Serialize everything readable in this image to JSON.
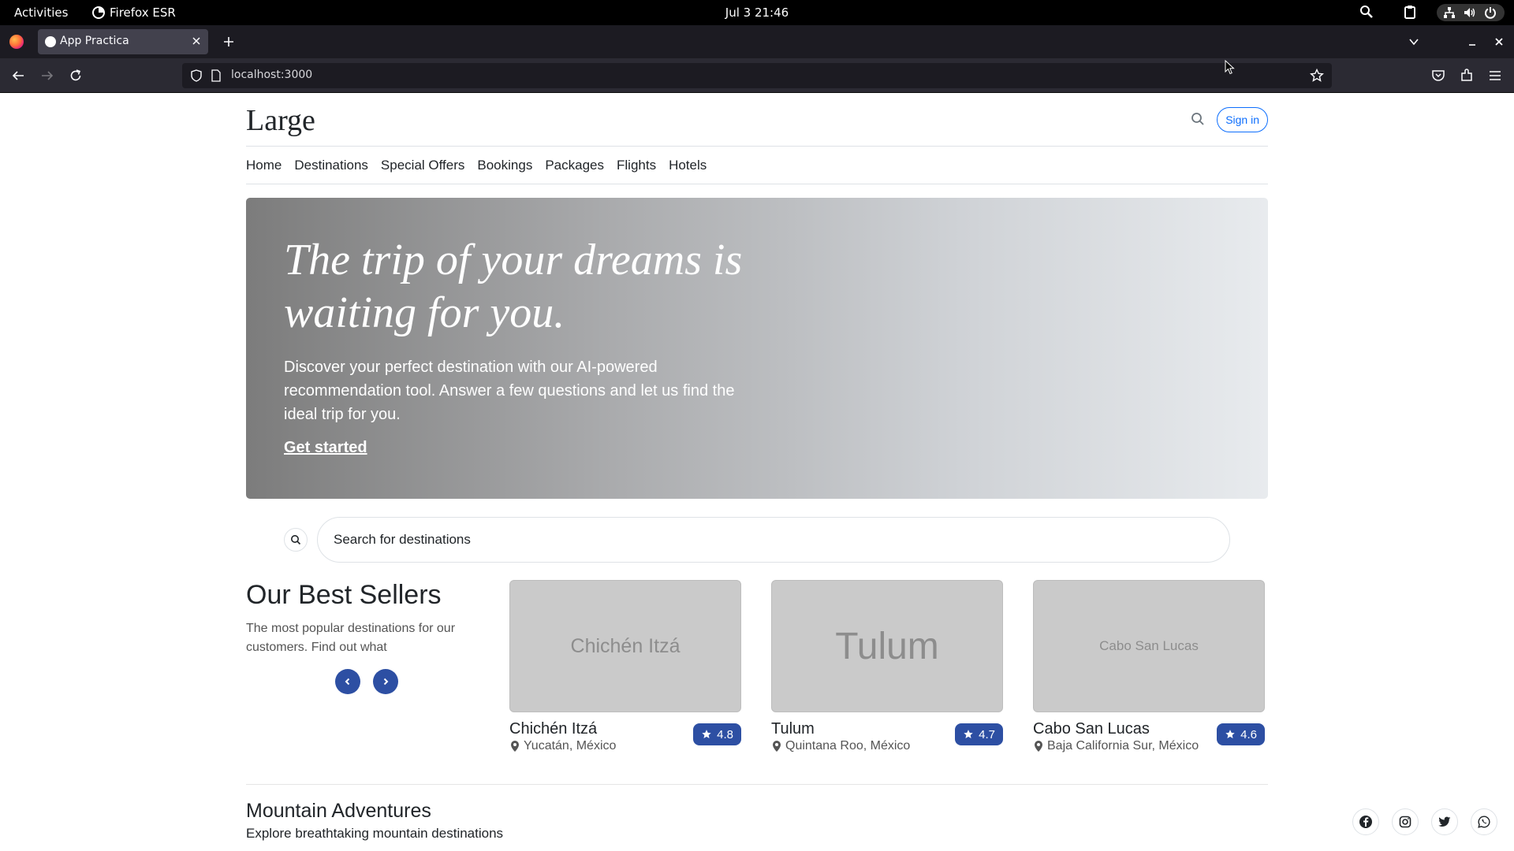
{
  "system": {
    "activities": "Activities",
    "app_name": "Firefox ESR",
    "clock": "Jul 3  21:46"
  },
  "browser": {
    "tab_title": "App Practica",
    "url": "localhost:3000"
  },
  "site": {
    "brand": "Large",
    "signin": "Sign in",
    "nav": [
      "Home",
      "Destinations",
      "Special Offers",
      "Bookings",
      "Packages",
      "Flights",
      "Hotels"
    ]
  },
  "hero": {
    "title": "The trip of your dreams is waiting for you.",
    "lead": "Discover your perfect destination with our AI-powered recommendation tool. Answer a few questions and let us find the ideal trip for you.",
    "cta": "Get started"
  },
  "search": {
    "placeholder": "Search for destinations"
  },
  "best_sellers": {
    "title": "Our Best Sellers",
    "subtitle": "The most popular destinations for our customers. Find out what",
    "cards": [
      {
        "thumb_text": "Chichén Itzá",
        "name": "Chichén Itzá",
        "location": "Yucatán, México",
        "rating": "4.8"
      },
      {
        "thumb_text": "Tulum",
        "name": "Tulum",
        "location": "Quintana Roo, México",
        "rating": "4.7"
      },
      {
        "thumb_text": "Cabo San Lucas",
        "name": "Cabo San Lucas",
        "location": "Baja California Sur, México",
        "rating": "4.6"
      }
    ]
  },
  "mountain": {
    "title": "Mountain Adventures",
    "subtitle": "Explore breathtaking mountain destinations"
  },
  "colors": {
    "accent": "#2d4fa3",
    "link": "#0d6efd"
  },
  "icons": {
    "socials": [
      "facebook-icon",
      "instagram-icon",
      "twitter-icon",
      "whatsapp-icon"
    ]
  }
}
